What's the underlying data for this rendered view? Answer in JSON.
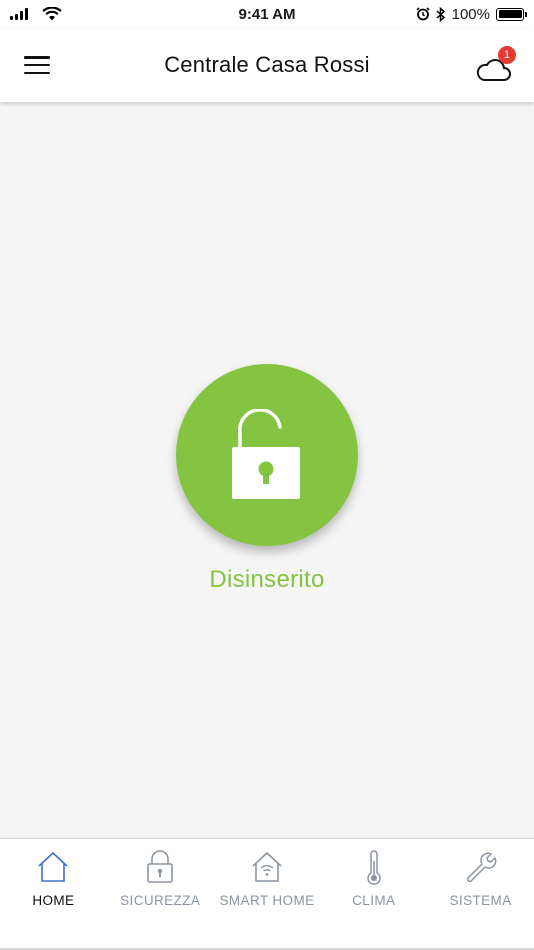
{
  "status_bar": {
    "time": "9:41 AM",
    "battery": "100%"
  },
  "header": {
    "title": "Centrale Casa Rossi",
    "notification_count": "1"
  },
  "main": {
    "alarm_state": "Disinserito",
    "accent_color": "#84c441"
  },
  "tabs": [
    {
      "label": "HOME",
      "icon": "home-icon",
      "active": true
    },
    {
      "label": "SICUREZZA",
      "icon": "lock-icon",
      "active": false
    },
    {
      "label": "SMART HOME",
      "icon": "smart-home-icon",
      "active": false
    },
    {
      "label": "CLIMA",
      "icon": "thermometer-icon",
      "active": false
    },
    {
      "label": "SISTEMA",
      "icon": "wrench-icon",
      "active": false
    }
  ],
  "colors": {
    "active_tab_icon": "#3d6fd1",
    "inactive_tab": "#8a94a3",
    "badge": "#e53935"
  }
}
